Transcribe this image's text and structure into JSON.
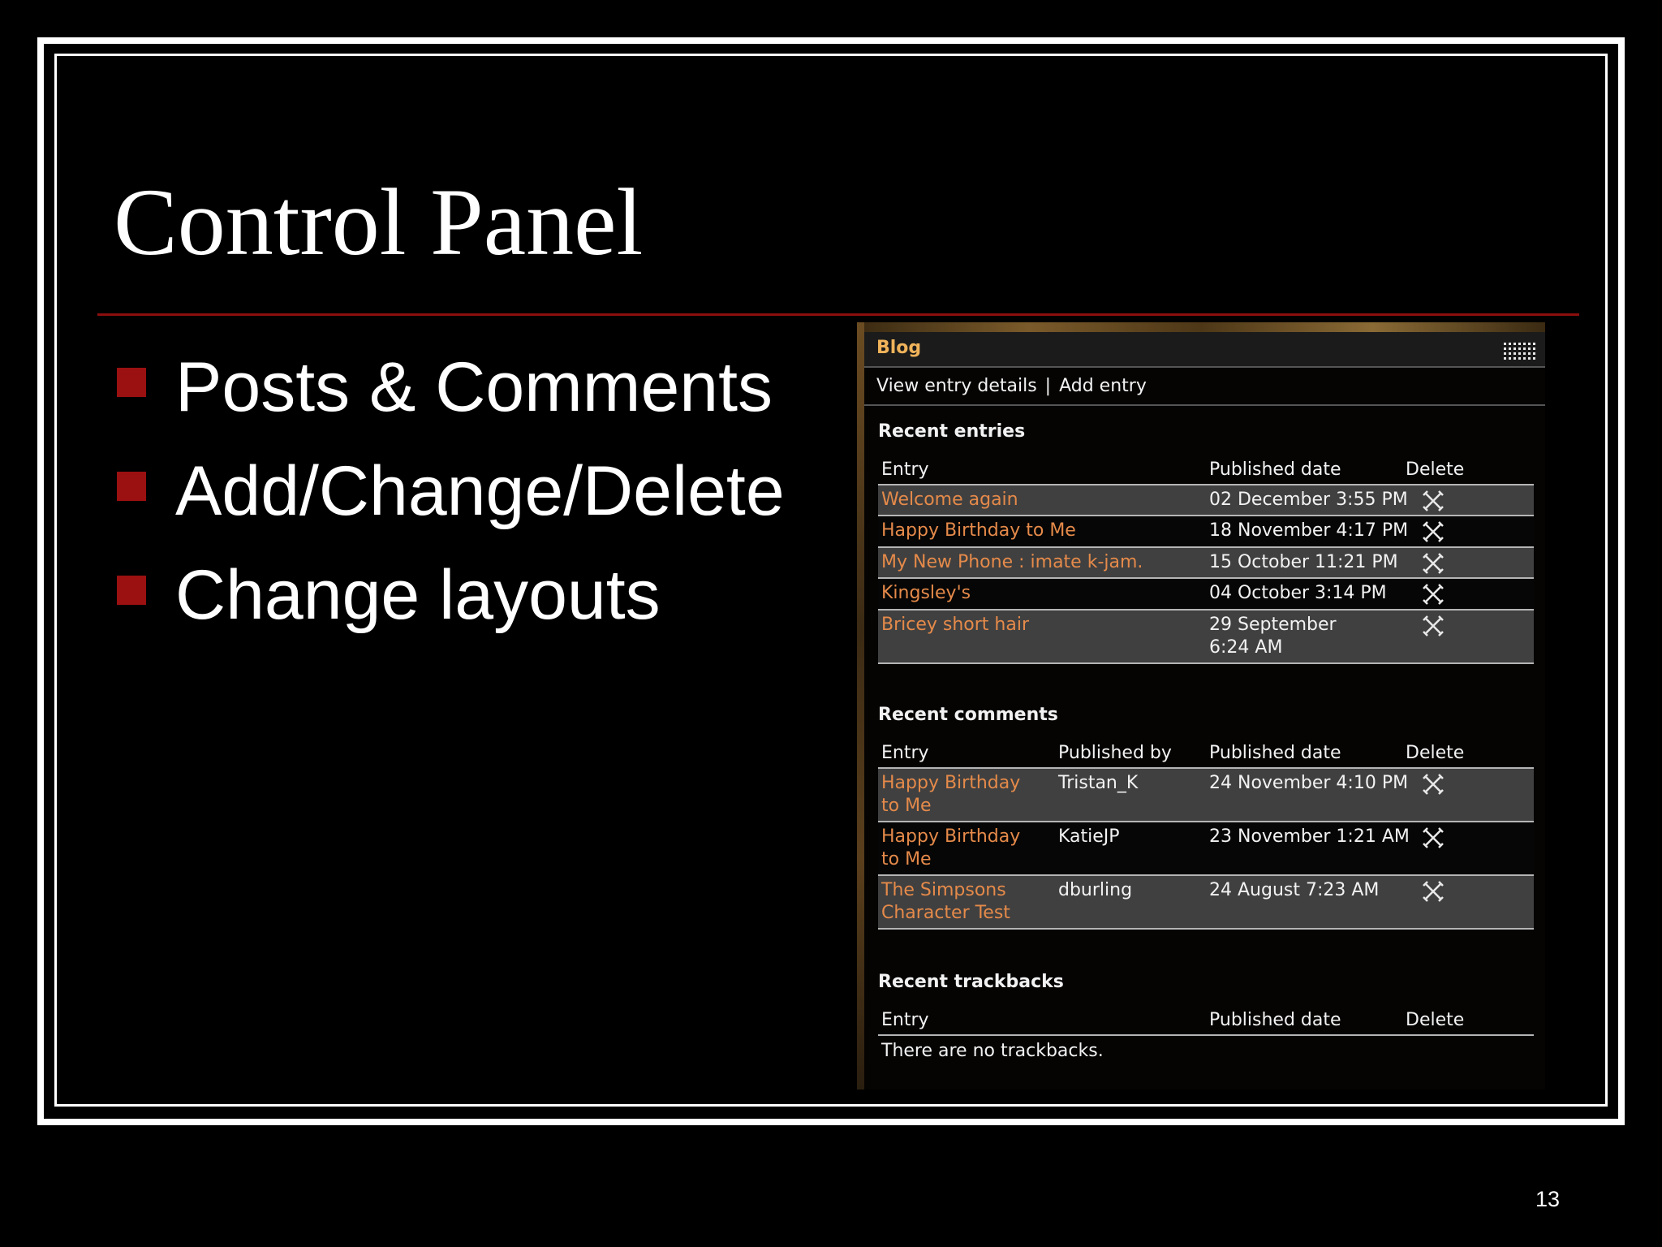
{
  "slide": {
    "title": "Control Panel",
    "bullets": [
      "Posts & Comments",
      "Add/Change/Delete",
      "Change layouts"
    ],
    "page_number": "13"
  },
  "colors": {
    "background": "#000000",
    "accent_red": "#9b1010",
    "link_orange": "#e58a4a",
    "widget_title": "#f0b35a"
  },
  "widget": {
    "title": "Blog",
    "menu_icon": "grid-icon",
    "links": {
      "view_details": "View entry details",
      "separator": "|",
      "add_entry": "Add entry"
    },
    "delete_icon": "cross-icon",
    "recent_entries": {
      "heading": "Recent entries",
      "headers": {
        "entry": "Entry",
        "published_date": "Published date",
        "delete": "Delete"
      },
      "rows": [
        {
          "entry": "Welcome again",
          "date": "02 December 3:55 PM"
        },
        {
          "entry": "Happy Birthday to Me",
          "date": "18 November 4:17 PM"
        },
        {
          "entry": "My New Phone : imate k-jam.",
          "date": "15 October 11:21 PM"
        },
        {
          "entry": "Kingsley's",
          "date": "04 October 3:14 PM"
        },
        {
          "entry": "Bricey short hair",
          "date": "29 September 6:24 AM"
        }
      ]
    },
    "recent_comments": {
      "heading": "Recent comments",
      "headers": {
        "entry": "Entry",
        "published_by": "Published by",
        "published_date": "Published date",
        "delete": "Delete"
      },
      "rows": [
        {
          "entry": "Happy Birthday to Me",
          "by": "Tristan_K",
          "date": "24 November 4:10 PM"
        },
        {
          "entry": "Happy Birthday to Me",
          "by": "KatieJP",
          "date": "23 November 1:21 AM"
        },
        {
          "entry": "The Simpsons Character Test",
          "by": "dburling",
          "date": "24 August 7:23 AM"
        }
      ]
    },
    "recent_trackbacks": {
      "heading": "Recent trackbacks",
      "headers": {
        "entry": "Entry",
        "published_date": "Published date",
        "delete": "Delete"
      },
      "empty_message": "There are no trackbacks."
    }
  }
}
